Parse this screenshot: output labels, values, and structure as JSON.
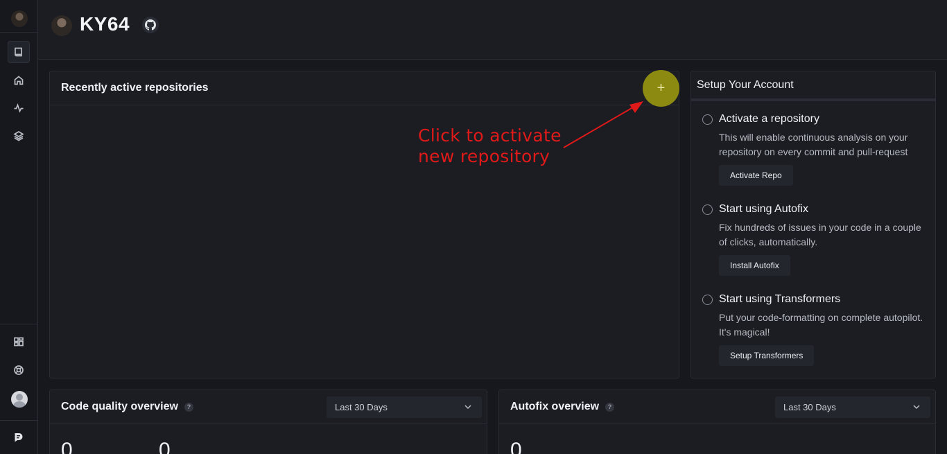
{
  "header": {
    "username": "KY64"
  },
  "sidebar": {
    "items": [
      {
        "name": "book-icon"
      },
      {
        "name": "home-icon"
      },
      {
        "name": "activity-icon"
      },
      {
        "name": "layers-icon"
      },
      {
        "name": "dashboard-icon"
      },
      {
        "name": "help-lifebuoy-icon"
      }
    ]
  },
  "repos": {
    "title": "Recently active repositories",
    "add_symbol": "+"
  },
  "annotation": {
    "line1": "Click to activate",
    "line2": "new repository",
    "color": "#e01919"
  },
  "setup": {
    "title": "Setup Your Account",
    "steps": [
      {
        "title": "Activate a repository",
        "desc": "This will enable continuous analysis on your repository on every commit and pull-request",
        "button": "Activate Repo"
      },
      {
        "title": "Start using Autofix",
        "desc": "Fix hundreds of issues in your code in a couple of clicks, automatically.",
        "button": "Install Autofix"
      },
      {
        "title": "Start using Transformers",
        "desc": "Put your code-formatting on complete autopilot. It's magical!",
        "button": "Setup Transformers"
      }
    ]
  },
  "code_quality": {
    "title": "Code quality overview",
    "help": "?",
    "range": "Last 30 Days",
    "values": [
      "0",
      "0"
    ]
  },
  "autofix": {
    "title": "Autofix overview",
    "help": "?",
    "range": "Last 30 Days",
    "values": [
      "0"
    ]
  },
  "colors": {
    "accent": "#8c8a10",
    "background": "#16181d",
    "panel": "#1b1d23"
  }
}
